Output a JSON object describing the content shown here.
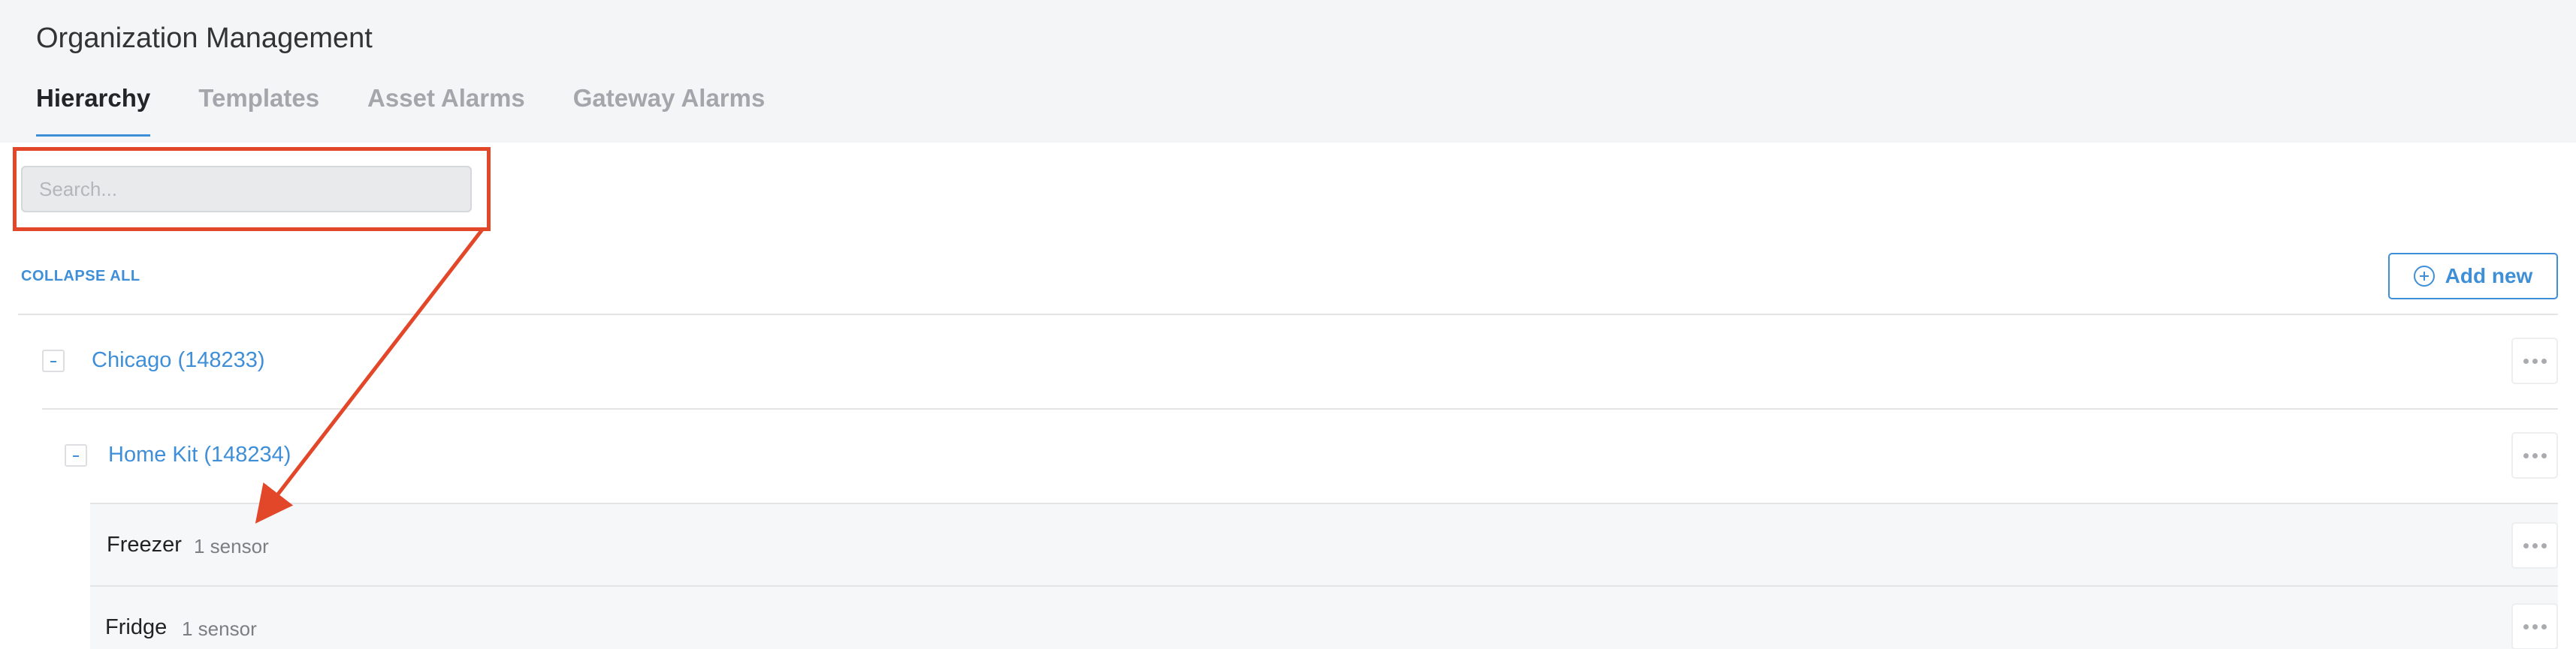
{
  "header": {
    "title": "Organization Management",
    "tabs": [
      {
        "label": "Hierarchy",
        "active": true
      },
      {
        "label": "Templates",
        "active": false
      },
      {
        "label": "Asset Alarms",
        "active": false
      },
      {
        "label": "Gateway Alarms",
        "active": false
      }
    ]
  },
  "search": {
    "placeholder": "Search...",
    "value": ""
  },
  "toolbar": {
    "collapse_all_label": "COLLAPSE ALL",
    "add_new_label": "Add new"
  },
  "tree": {
    "nodes": [
      {
        "label": "Chicago (148233)"
      },
      {
        "label": "Home Kit (148234)"
      }
    ],
    "leaves": [
      {
        "name": "Freezer",
        "count": "1 sensor"
      },
      {
        "name": "Fridge",
        "count": "1 sensor"
      }
    ]
  },
  "icons": {
    "add": "plus-circle-icon",
    "more": "ellipsis-icon",
    "collapse": "minus-icon"
  },
  "colors": {
    "accent": "#3f8fd8",
    "annotation": "#e3472a",
    "header_bg": "#f4f5f7"
  }
}
